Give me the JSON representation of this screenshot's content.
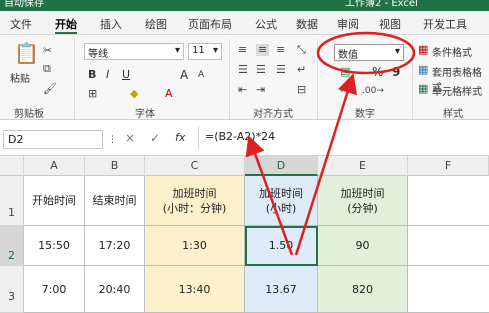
{
  "title_bar": {
    "left_text": "自动保存",
    "right_text": "工作簿2 - Excel"
  },
  "tabs": [
    {
      "label": "文件"
    },
    {
      "label": "开始"
    },
    {
      "label": "插入"
    },
    {
      "label": "绘图"
    },
    {
      "label": "页面布局"
    },
    {
      "label": "公式"
    },
    {
      "label": "数据"
    },
    {
      "label": "审阅"
    },
    {
      "label": "视图"
    },
    {
      "label": "开发工具"
    }
  ],
  "ribbon": {
    "clipboard": {
      "paste_label": "粘贴",
      "group_label": "剪贴板"
    },
    "font": {
      "font_name": "等线",
      "font_size": "11",
      "bold": "B",
      "italic": "I",
      "underline": "U",
      "grow": "A",
      "shrink": "A",
      "group_label": "字体"
    },
    "alignment": {
      "group_label": "对齐方式"
    },
    "number": {
      "format_value": "数值",
      "percent": "%",
      "comma": "9",
      "group_label": "数字"
    },
    "styles": {
      "conditional": "条件格式",
      "table": "套用表格格式",
      "cell": "单元格样式",
      "group_label": "样式"
    }
  },
  "formula_bar": {
    "name_box": "D2",
    "cancel": "×",
    "enter": "✓",
    "fx": "fx",
    "formula": "=(B2-A2)*24"
  },
  "sheet": {
    "columns": [
      "A",
      "B",
      "C",
      "D",
      "E",
      "F"
    ],
    "rows": [
      "1",
      "2",
      "3"
    ],
    "header_row": [
      "开始时间",
      "结束时间",
      "加班时间\n(小时：分钟)",
      "加班时间\n(小时)",
      "加班时间\n(分钟)",
      ""
    ],
    "row2": [
      "15:50",
      "17:20",
      "1:30",
      "1.50",
      "90",
      ""
    ],
    "row3": [
      "7:00",
      "20:40",
      "13:40",
      "13.67",
      "820",
      ""
    ]
  },
  "annotation_color": "#e02020"
}
